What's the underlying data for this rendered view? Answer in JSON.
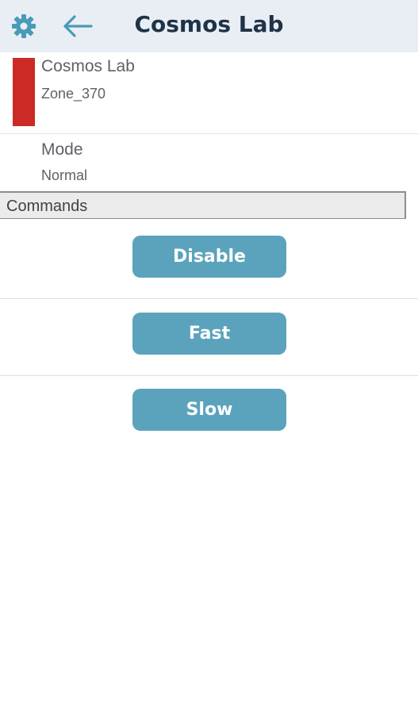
{
  "header": {
    "title": "Cosmos Lab",
    "settings_icon": "gear-icon",
    "back_icon": "arrow-left-icon",
    "icon_color": "#4a9ab8",
    "background": "#e9eef5"
  },
  "device": {
    "name": "Cosmos Lab",
    "zone": "Zone_370",
    "status_color": "#cc2a24"
  },
  "mode": {
    "label": "Mode",
    "value": "Normal"
  },
  "commands": {
    "section_label": "Commands",
    "button_color": "#5ba3bc",
    "buttons": [
      {
        "label": "Disable"
      },
      {
        "label": "Fast"
      },
      {
        "label": "Slow"
      }
    ]
  }
}
